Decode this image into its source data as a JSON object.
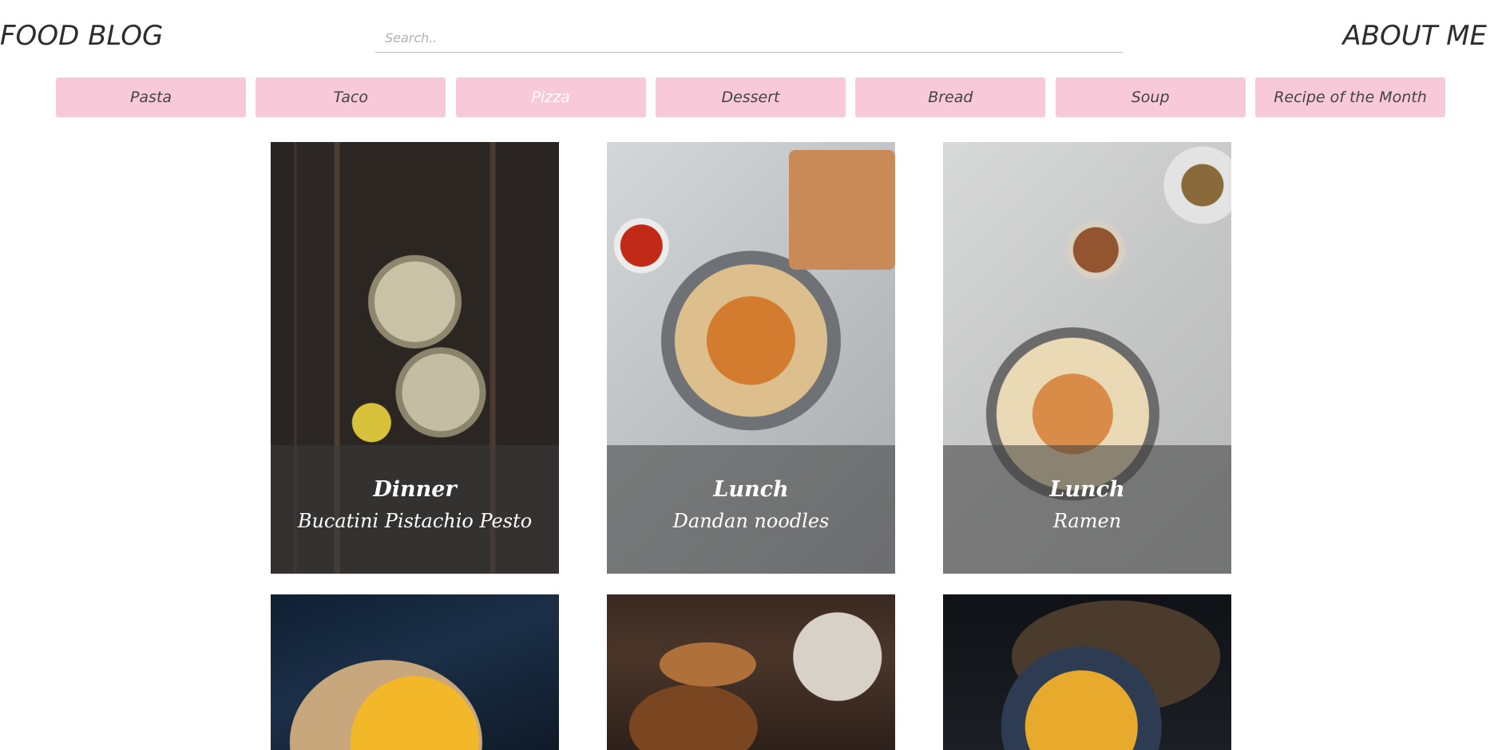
{
  "header": {
    "logo": "FOOD BLOG",
    "search_placeholder": "Search..",
    "about": "ABOUT ME"
  },
  "nav": {
    "items": [
      {
        "label": "Pasta",
        "active": false
      },
      {
        "label": "Taco",
        "active": false
      },
      {
        "label": "Pizza",
        "active": true
      },
      {
        "label": "Dessert",
        "active": false
      },
      {
        "label": "Bread",
        "active": false
      },
      {
        "label": "Soup",
        "active": false
      },
      {
        "label": "Recipe of the Month",
        "active": false
      }
    ],
    "button_color": "#f8c9d9"
  },
  "cards": [
    {
      "category": "Dinner",
      "title": "Bucatini Pistachio Pesto"
    },
    {
      "category": "Lunch",
      "title": "Dandan noodles"
    },
    {
      "category": "Lunch",
      "title": "Ramen"
    },
    {
      "category": "",
      "title": ""
    },
    {
      "category": "",
      "title": ""
    },
    {
      "category": "",
      "title": ""
    }
  ]
}
